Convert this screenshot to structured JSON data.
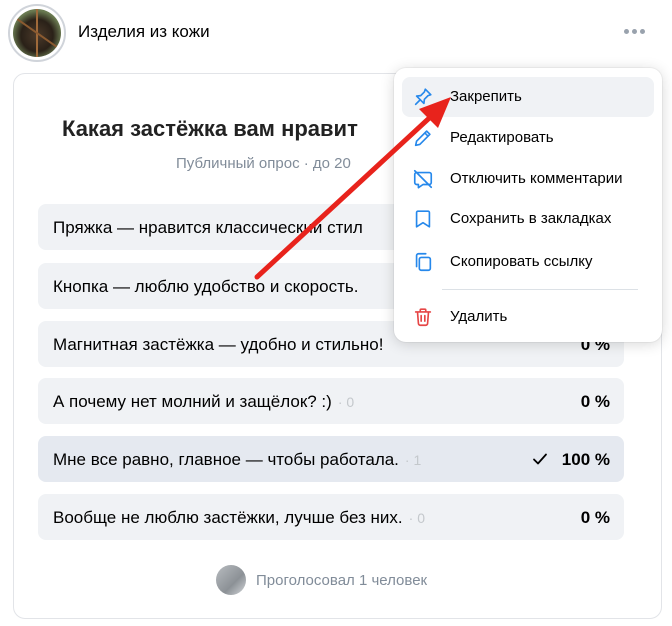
{
  "header": {
    "group_name": "Изделия из кожи",
    "avatar_icon": "group-avatar",
    "more_icon": "more-horizontal-icon"
  },
  "poll": {
    "title": "Какая застёжка вам нравит",
    "meta": "Публичный опрос · до 20",
    "options": [
      {
        "text": "Пряжка — нравится классический стил",
        "count": "",
        "percent": "",
        "selected": false
      },
      {
        "text": "Кнопка — люблю удобство и скорость.",
        "count": "",
        "percent": "",
        "selected": false
      },
      {
        "text": "Магнитная застёжка — удобно и стильно!",
        "count": "",
        "percent": "0 %",
        "selected": false
      },
      {
        "text": "А почему нет молний и защёлок? :)",
        "count": "· 0",
        "percent": "0 %",
        "selected": false
      },
      {
        "text": "Мне все равно, главное — чтобы работала.",
        "count": "· 1",
        "percent": "100 %",
        "selected": true
      },
      {
        "text": "Вообще не люблю застёжки, лучше без них.",
        "count": "· 0",
        "percent": "0 %",
        "selected": false
      }
    ],
    "voters_text": "Проголосовал 1 человек"
  },
  "menu": {
    "items": [
      {
        "label": "Закрепить",
        "icon": "pin-icon"
      },
      {
        "label": "Редактировать",
        "icon": "pencil-icon"
      },
      {
        "label": "Отключить комментарии",
        "icon": "comment-off-icon"
      },
      {
        "label": "Сохранить в закладках",
        "icon": "bookmark-icon"
      },
      {
        "label": "Скопировать ссылку",
        "icon": "copy-icon"
      },
      {
        "label": "Удалить",
        "icon": "trash-icon"
      }
    ]
  },
  "colors": {
    "accent": "#2688eb",
    "danger": "#e64646",
    "annotation_arrow": "#e8231c",
    "option_bg": "#f0f2f5",
    "option_selected_bg": "#e5e9f0"
  }
}
